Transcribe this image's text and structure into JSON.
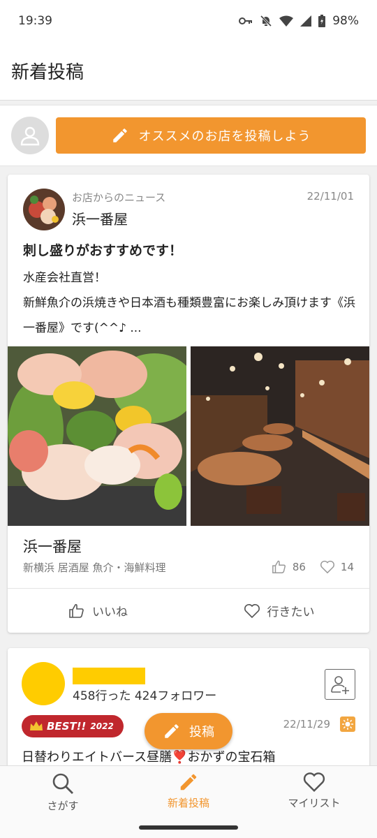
{
  "status_bar": {
    "time": "19:39",
    "battery": "98%"
  },
  "app_bar": {
    "title": "新着投稿"
  },
  "compose": {
    "button_label": "オススメのお店を投稿しよう"
  },
  "news_post": {
    "kicker": "お店からのニュース",
    "date": "22/11/01",
    "shop_name": "浜一番屋",
    "title": "刺し盛りがおすすめです！",
    "body_line1": "水産会社直営！",
    "body_line2": "新鮮魚介の浜焼きや日本酒も種類豊富にお楽しみ頂けます《浜一番屋》です(^^♪ ...",
    "place_name": "浜一番屋",
    "place_tags": "新横浜 居酒屋 魚介・海鮮料理",
    "like_count": "86",
    "want_count": "14",
    "like_label": "いいね",
    "want_label": "行きたい"
  },
  "user_post": {
    "went_count": "458行った",
    "follower_count": "424フォロワー",
    "badge_label": "BEST!!",
    "badge_year": "2022",
    "date": "22/11/29",
    "title": "日替わりエイトバース昼膳❣️おかずの宝石箱"
  },
  "fab": {
    "label": "投稿"
  },
  "bottom_nav": {
    "search_label": "さがす",
    "new_label": "新着投稿",
    "mylist_label": "マイリスト"
  },
  "colors": {
    "accent": "#f2962f",
    "badge_red": "#c0272d",
    "user_yellow": "#ffcc00"
  }
}
